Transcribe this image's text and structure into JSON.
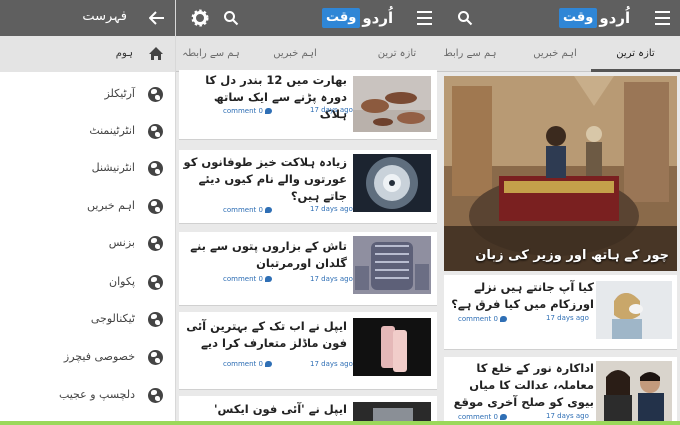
{
  "colors": {
    "appbar": "#5f5f5f",
    "logo_blue": "#2f86d6",
    "link_blue": "#2f6fb5",
    "tab_bg": "#e4e4e4"
  },
  "logo": {
    "urdu": "اُردو",
    "waqt": "وقت"
  },
  "menu": {
    "title": "فہرست",
    "home": "ہوم",
    "items": [
      {
        "label": "آرٹیکلز"
      },
      {
        "label": "انٹرٹینمنٹ"
      },
      {
        "label": "انٹرنیشنل"
      },
      {
        "label": "اہم خبریں"
      },
      {
        "label": "بزنس"
      },
      {
        "label": "پکوان"
      },
      {
        "label": "ٹیکنالوجی"
      },
      {
        "label": "خصوصی فیچرز"
      },
      {
        "label": "دلچسپ و عجیب"
      }
    ]
  },
  "middle": {
    "tabs": [
      {
        "label": "ہم سے رابطہ"
      },
      {
        "label": "اہم خبریں"
      },
      {
        "label": "تازہ ترین"
      }
    ],
    "articles": [
      {
        "title": "بھارت میں 12 بندر دل کا دورہ پڑنے سے ایک ساتھ ہلاک",
        "date": "17 days ago",
        "comments": "comment 0"
      },
      {
        "title": "زیادہ ہلاکت خیز طوفانوں کو عورتوں والے نام کیوں دیئے جاتے ہیں؟",
        "date": "17 days ago",
        "comments": "comment 0"
      },
      {
        "title": "تاش کے بزاروں پتوں سے بنے گلدان اورمرتبان",
        "date": "17 days ago",
        "comments": "comment 0"
      },
      {
        "title": "ایپل نے اب تک کے بہترین آئی فون ماڈلز متعارف کرا دیے",
        "date": "17 days ago",
        "comments": "comment 0"
      },
      {
        "title": "ایپل نے 'آئی فون ایکس' متعارف"
      }
    ]
  },
  "right": {
    "tabs": [
      {
        "label": "ہم سے رابط"
      },
      {
        "label": "اہم خبریں"
      },
      {
        "label": "تازہ ترین"
      }
    ],
    "hero_caption": "چور کے ہاتھ اور وزیر کی زبان",
    "articles": [
      {
        "title": "کیا آپ جانتے ہیں نزلے اورزکام میں کیا فرق ہے؟",
        "date": "17 days ago",
        "comments": "comment 0"
      },
      {
        "title": "اداکارہ نور کے خلع کا معاملہ، عدالت کا میاں بیوی کو صلح آخری موقع",
        "date": "17 days ago",
        "comments": "comment 0"
      }
    ]
  }
}
